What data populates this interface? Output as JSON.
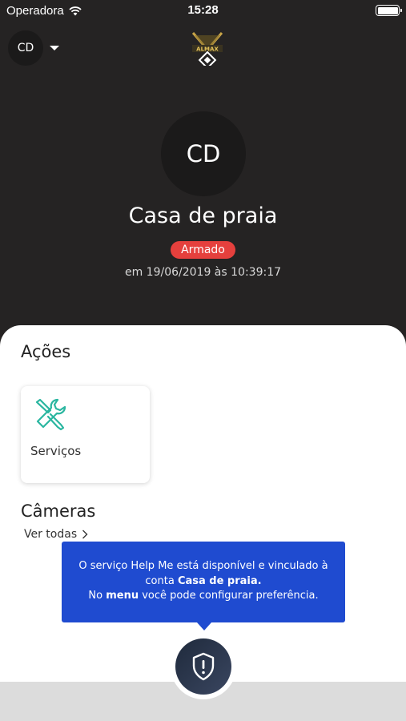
{
  "status_bar": {
    "carrier": "Operadora",
    "time": "15:28"
  },
  "header": {
    "account_initials": "CD"
  },
  "profile": {
    "initials": "CD",
    "name": "Casa de praia",
    "status": "Armado",
    "status_color": "#e5403d",
    "date": "em 19/06/2019 às 10:39:17"
  },
  "actions": {
    "title": "Ações",
    "items": [
      {
        "label": "Serviços",
        "icon": "tools-icon",
        "icon_color": "#2ab6a0"
      }
    ]
  },
  "cameras": {
    "title": "Câmeras",
    "see_all": "Ver todas"
  },
  "tooltip": {
    "line1": "O serviço Help Me está disponível e vinculado à",
    "line2_prefix": "conta ",
    "line2_bold": "Casa de praia.",
    "line3_prefix": "No ",
    "line3_bold": "menu",
    "line3_suffix": " você pode configurar preferência.",
    "bg_color": "#1f4bd0"
  },
  "fab": {
    "icon": "shield-alert-icon"
  }
}
